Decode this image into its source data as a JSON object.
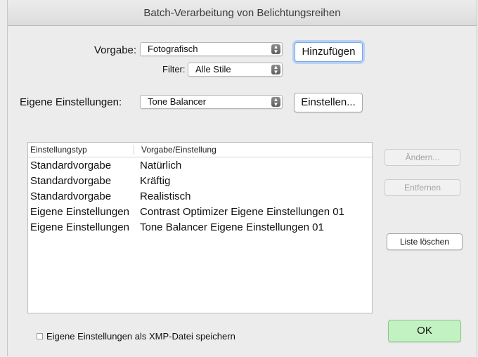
{
  "window": {
    "title": "Batch-Verarbeitung von Belichtungsreihen"
  },
  "preset": {
    "label": "Vorgabe:",
    "value": "Fotografisch",
    "add_button": "Hinzufügen"
  },
  "filter": {
    "label": "Filter:",
    "value": "Alle Stile"
  },
  "custom": {
    "label": "Eigene Einstellungen:",
    "value": "Tone Balancer",
    "settings_button": "Einstellen..."
  },
  "table": {
    "columns": [
      "Einstellungstyp",
      "Vorgabe/Einstellung"
    ],
    "rows": [
      {
        "type": "Standardvorgabe",
        "setting": "Natürlich"
      },
      {
        "type": "Standardvorgabe",
        "setting": "Kräftig"
      },
      {
        "type": "Standardvorgabe",
        "setting": "Realistisch"
      },
      {
        "type": "Eigene Einstellungen",
        "setting": "Contrast Optimizer Eigene Einstellungen 01"
      },
      {
        "type": "Eigene Einstellungen",
        "setting": "Tone Balancer Eigene Einstellungen 01"
      }
    ]
  },
  "side_buttons": {
    "edit": "Ändern...",
    "remove": "Entfernen",
    "clear": "Liste löschen"
  },
  "footer": {
    "xmp_checkbox_label": "Eigene Einstellungen als XMP-Datei speichern",
    "xmp_checked": false,
    "ok": "OK"
  },
  "colors": {
    "ok_button": "#c2f2c2",
    "focus_ring": "#b7d1f5"
  }
}
